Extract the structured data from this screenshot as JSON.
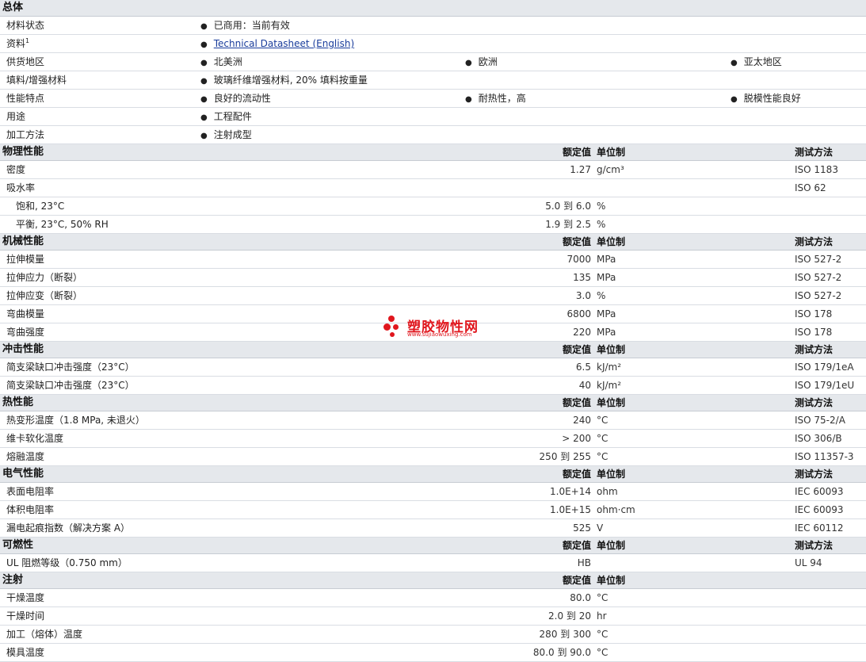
{
  "general": {
    "title": "总体",
    "rows": [
      {
        "label": "材料状态",
        "items": [
          "已商用：当前有效"
        ]
      },
      {
        "label": "资料",
        "sup": "1",
        "link": "Technical Datasheet (English)"
      },
      {
        "label": "供货地区",
        "items": [
          "北美洲",
          "欧洲",
          "亚太地区"
        ]
      },
      {
        "label": "填料/增强材料",
        "items": [
          "玻璃纤维增强材料, 20% 填料按重量"
        ]
      },
      {
        "label": "性能特点",
        "items": [
          "良好的流动性",
          "耐热性，高",
          "脱模性能良好"
        ]
      },
      {
        "label": "用途",
        "items": [
          "工程配件"
        ]
      },
      {
        "label": "加工方法",
        "items": [
          "注射成型"
        ]
      }
    ]
  },
  "columns": {
    "value": "额定值",
    "unit": "单位制",
    "method": "测试方法"
  },
  "sections": [
    {
      "title": "物理性能",
      "rows": [
        {
          "label": "密度",
          "value": "1.27",
          "unit": "g/cm³",
          "method": "ISO 1183"
        },
        {
          "label": "吸水率",
          "value": "",
          "unit": "",
          "method": "ISO 62"
        },
        {
          "label": "饱和, 23°C",
          "sub": true,
          "value": "5.0 到  6.0",
          "unit": "%",
          "method": ""
        },
        {
          "label": "平衡, 23°C, 50% RH",
          "sub": true,
          "value": "1.9 到  2.5",
          "unit": "%",
          "method": ""
        }
      ]
    },
    {
      "title": "机械性能",
      "rows": [
        {
          "label": "拉伸模量",
          "value": "7000",
          "unit": "MPa",
          "method": "ISO 527-2"
        },
        {
          "label": "拉伸应力（断裂）",
          "value": "135",
          "unit": "MPa",
          "method": "ISO 527-2"
        },
        {
          "label": "拉伸应变（断裂）",
          "value": "3.0",
          "unit": "%",
          "method": "ISO 527-2"
        },
        {
          "label": "弯曲模量",
          "value": "6800",
          "unit": "MPa",
          "method": "ISO 178"
        },
        {
          "label": "弯曲强度",
          "value": "220",
          "unit": "MPa",
          "method": "ISO 178"
        }
      ]
    },
    {
      "title": "冲击性能",
      "rows": [
        {
          "label": "简支梁缺口冲击强度（23°C）",
          "value": "6.5",
          "unit": "kJ/m²",
          "method": "ISO 179/1eA"
        },
        {
          "label": "简支梁缺口冲击强度（23°C）",
          "value": "40",
          "unit": "kJ/m²",
          "method": "ISO 179/1eU"
        }
      ]
    },
    {
      "title": "热性能",
      "rows": [
        {
          "label": "热变形温度（1.8 MPa, 未退火）",
          "value": "240",
          "unit": "°C",
          "method": "ISO 75-2/A"
        },
        {
          "label": "维卡软化温度",
          "value": "> 200",
          "unit": "°C",
          "method": "ISO 306/B"
        },
        {
          "label": "熔融温度",
          "value": "250 到  255",
          "unit": "°C",
          "method": "ISO 11357-3"
        }
      ]
    },
    {
      "title": "电气性能",
      "rows": [
        {
          "label": "表面电阻率",
          "value": "1.0E+14",
          "unit": "ohm",
          "method": "IEC 60093"
        },
        {
          "label": "体积电阻率",
          "value": "1.0E+15",
          "unit": "ohm·cm",
          "method": "IEC 60093"
        },
        {
          "label": "漏电起痕指数（解决方案  A）",
          "value": "525",
          "unit": "V",
          "method": "IEC 60112"
        }
      ]
    },
    {
      "title": "可燃性",
      "rows": [
        {
          "label": "UL 阻燃等级（0.750 mm）",
          "value": "HB",
          "unit": "",
          "method": "UL 94"
        }
      ]
    },
    {
      "title": "注射",
      "hideMethod": true,
      "rows": [
        {
          "label": "干燥温度",
          "value": "80.0",
          "unit": "°C",
          "method": ""
        },
        {
          "label": "干燥时间",
          "value": "2.0 到  20",
          "unit": "hr",
          "method": ""
        },
        {
          "label": "加工（熔体）温度",
          "value": "280 到  300",
          "unit": "°C",
          "method": ""
        },
        {
          "label": "模具温度",
          "value": "80.0 到  90.0",
          "unit": "°C",
          "method": ""
        }
      ]
    }
  ],
  "watermark": {
    "name": "塑胶物性网",
    "url": "www.sujiaowuxing.com"
  }
}
